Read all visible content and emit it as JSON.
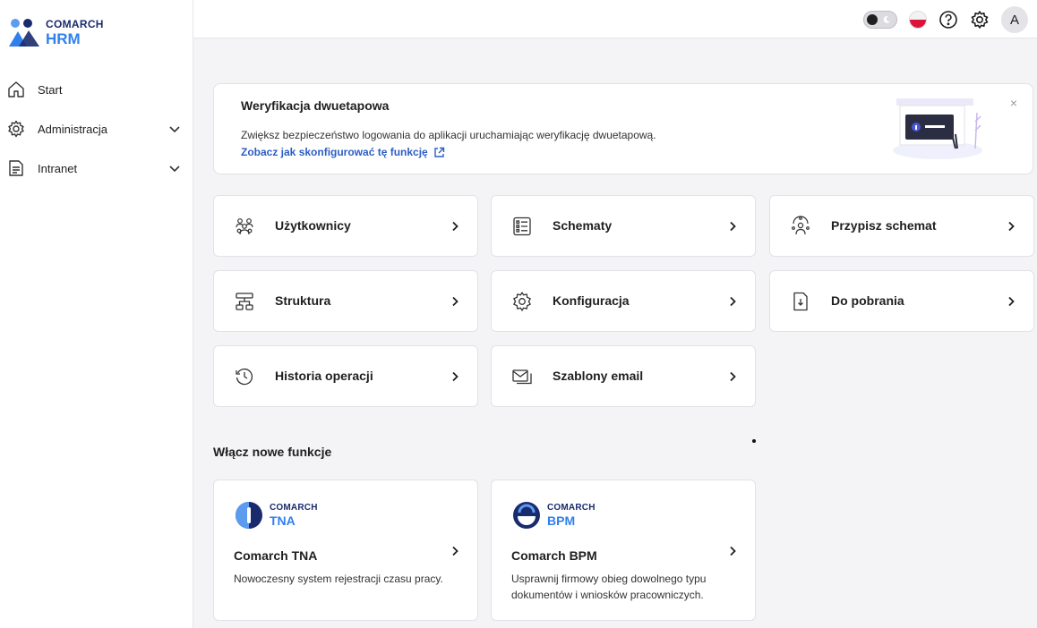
{
  "app": {
    "brand": "COMARCH",
    "product": "HRM"
  },
  "sidebar": {
    "items": [
      {
        "label": "Start"
      },
      {
        "label": "Administracja"
      },
      {
        "label": "Intranet"
      }
    ]
  },
  "header": {
    "avatar_initial": "A"
  },
  "banner": {
    "title": "Weryfikacja dwuetapowa",
    "text": "Zwiększ bezpieczeństwo logowania do aplikacji uruchamiając weryfikację dwuetapową.",
    "link": "Zobacz jak skonfigurować tę funkcję"
  },
  "tiles": [
    {
      "label": "Użytkownicy",
      "icon": "users-icon"
    },
    {
      "label": "Schematy",
      "icon": "list-icon"
    },
    {
      "label": "Przypisz schemat",
      "icon": "assign-icon"
    },
    {
      "label": "Struktura",
      "icon": "structure-icon"
    },
    {
      "label": "Konfiguracja",
      "icon": "gear-icon"
    },
    {
      "label": "Do pobrania",
      "icon": "download-icon"
    },
    {
      "label": "Historia operacji",
      "icon": "history-icon"
    },
    {
      "label": "Szablony email",
      "icon": "mail-icon"
    }
  ],
  "section": {
    "title": "Włącz nowe funkcje"
  },
  "products": [
    {
      "brand": "COMARCH",
      "product": "TNA",
      "name": "Comarch TNA",
      "desc": "Nowoczesny system rejestracji czasu pracy."
    },
    {
      "brand": "COMARCH",
      "product": "BPM",
      "name": "Comarch BPM",
      "desc": "Usprawnij firmowy obieg dowolnego typu dokumentów i wniosków pracowniczych."
    }
  ],
  "colors": {
    "brand_dark": "#1a2b6d",
    "brand_blue": "#2f80ed",
    "link": "#2c5ec4"
  }
}
